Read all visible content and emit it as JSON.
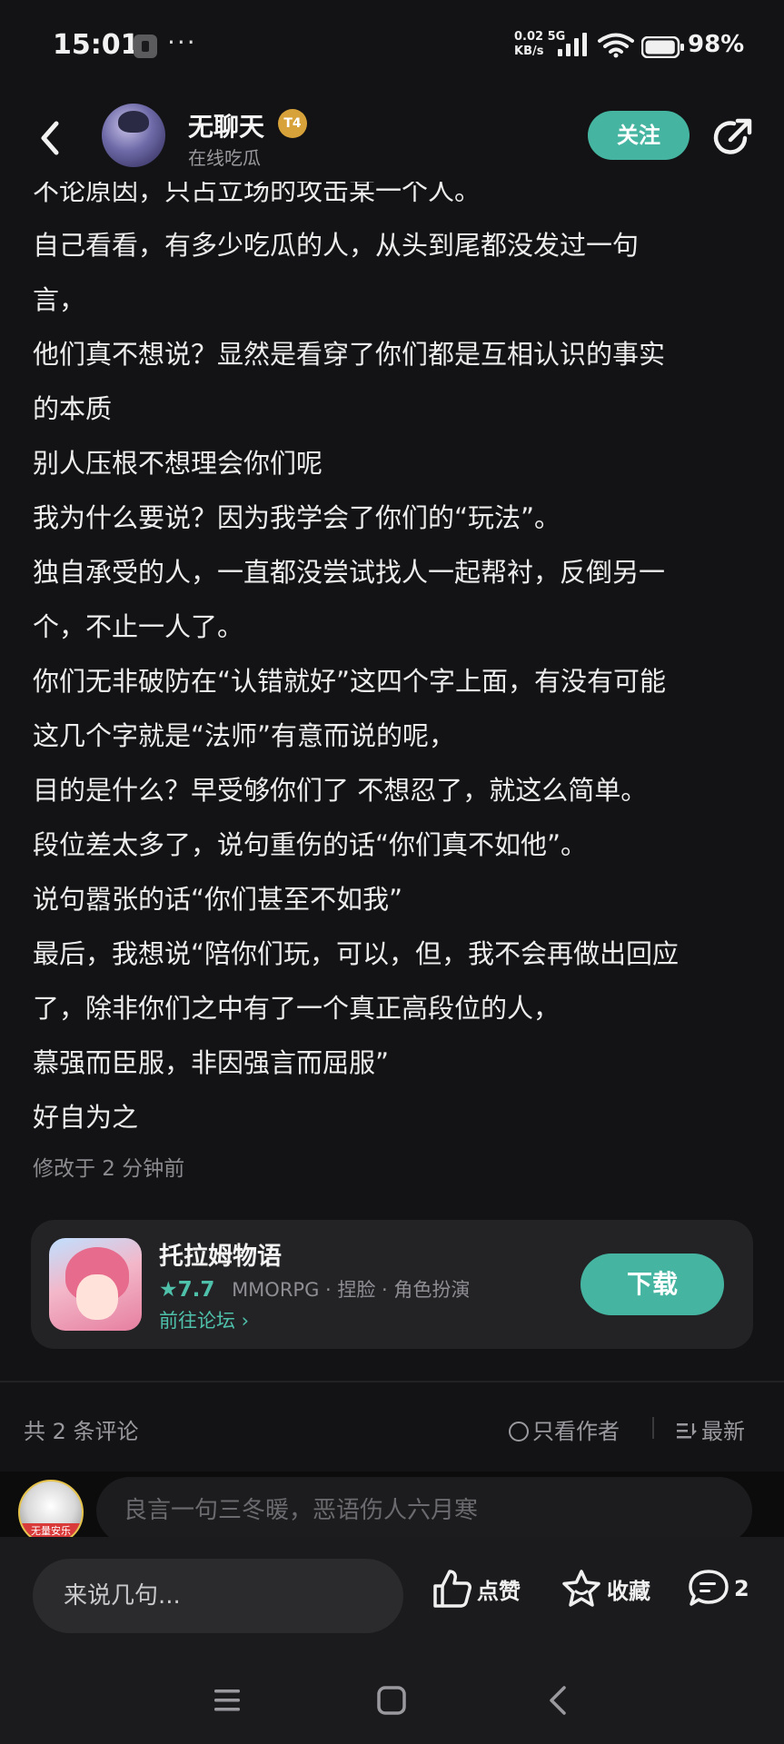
{
  "status_bar": {
    "time": "15:01",
    "more_dots": "···",
    "net_speed_value": "0.02",
    "net_speed_unit": "KB/s",
    "net_type": "5G",
    "battery_percent": "98%",
    "battery_level": 0.98
  },
  "header": {
    "author_name": "无聊天",
    "level_badge": "T4",
    "author_subtitle": "在线吃瓜",
    "follow_label": "关注"
  },
  "article": {
    "lines": [
      "不论原因，只占立场的攻击某一个人。",
      "自己看看，有多少吃瓜的人，从头到尾都没发过一句",
      "言，",
      "他们真不想说？显然是看穿了你们都是互相认识的事实",
      "的本质",
      "别人压根不想理会你们呢",
      "我为什么要说？因为我学会了你们的“玩法”。",
      "独自承受的人，一直都没尝试找人一起帮衬，反倒另一",
      "个，不止一人了。",
      "你们无非破防在“认错就好”这四个字上面，有没有可能",
      "这几个字就是“法师”有意而说的呢，",
      "目的是什么？早受够你们了 不想忍了，就这么简单。",
      "段位差太多了，说句重伤的话“你们真不如他”。",
      "说句嚣张的话“你们甚至不如我”",
      "最后，我想说“陪你们玩，可以，但，我不会再做出回应",
      "了，除非你们之中有了一个真正高段位的人，",
      "慕强而臣服，非因强言而屈服”",
      "好自为之"
    ],
    "modified": "修改于 2 分钟前"
  },
  "app_card": {
    "name": "托拉姆物语",
    "rating": "★7.7",
    "tags": "MMORPG · 捏脸 · 角色扮演",
    "forum_link": "前往论坛 ›",
    "download_label": "下载"
  },
  "comments": {
    "count_label": "共 2 条评论",
    "only_author_label": "只看作者",
    "sort_label": "最新",
    "commenter_tag": "无量安乐",
    "input_placeholder": "良言一句三冬暖，恶语伤人六月寒"
  },
  "bottom_bar": {
    "say_placeholder": "来说几句...",
    "like_label": "点赞",
    "favorite_label": "收藏",
    "comment_count": "2"
  },
  "colors": {
    "accent": "#45b5a1",
    "background": "#131315",
    "card": "#232326"
  }
}
